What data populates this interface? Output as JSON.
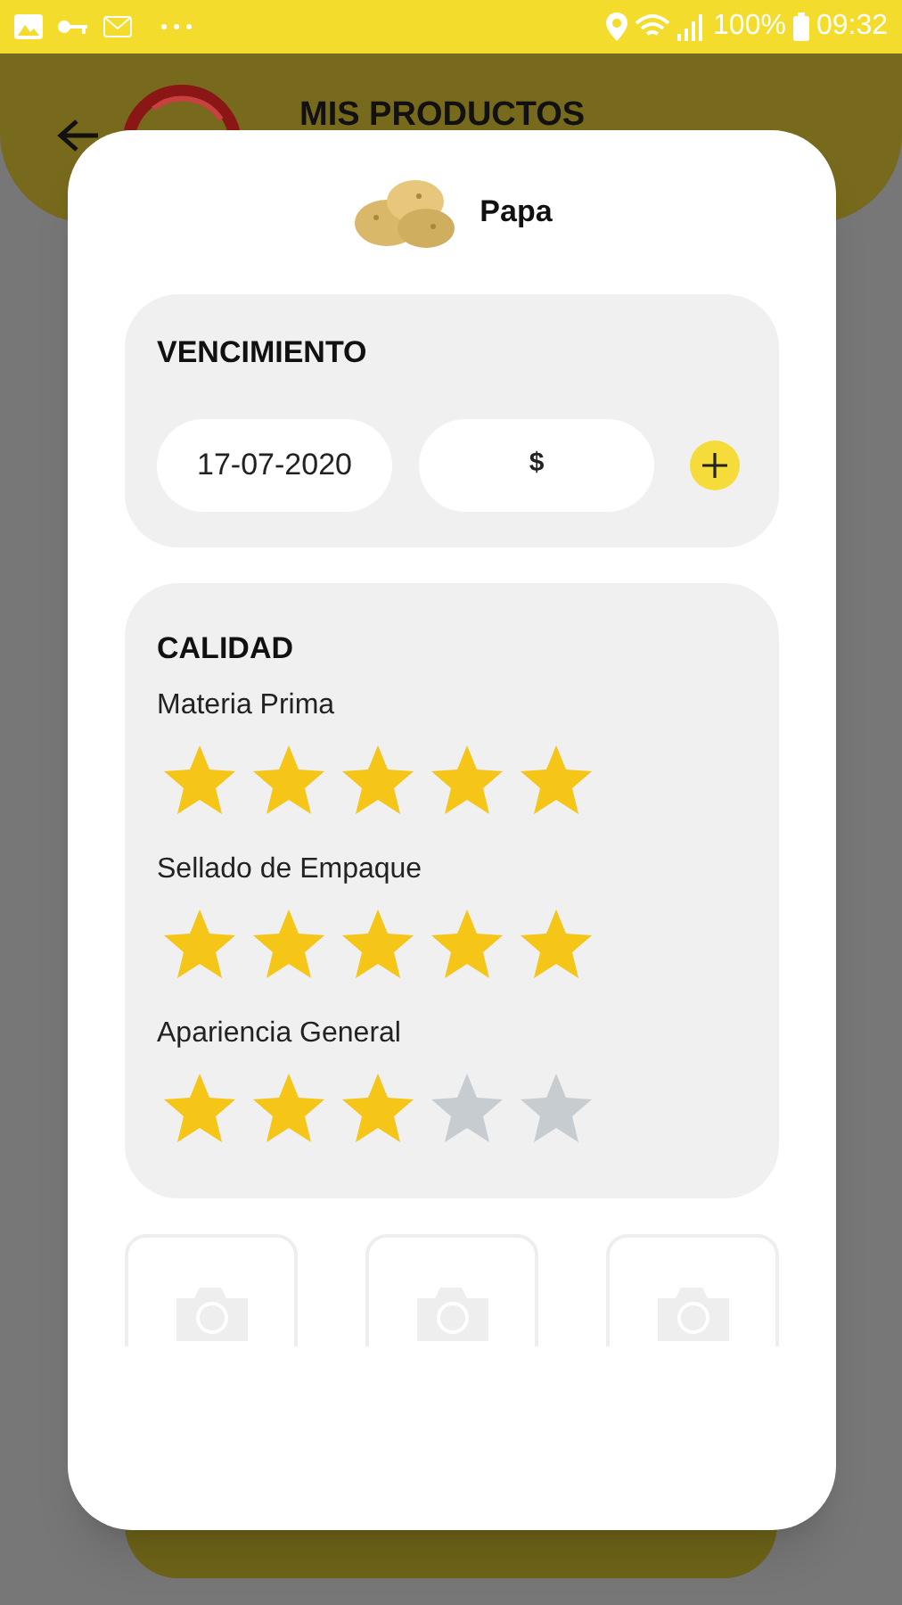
{
  "status_bar": {
    "battery": "100%",
    "time": "09:32"
  },
  "header": {
    "title": "MIS PRODUCTOS"
  },
  "dialog": {
    "product": {
      "name": "Papa"
    },
    "expiry": {
      "title": "VENCIMIENTO",
      "date": "17-07-2020",
      "price_prefix": "$"
    },
    "quality": {
      "title": "CALIDAD",
      "criteria": [
        {
          "label": "Materia Prima",
          "stars": 5
        },
        {
          "label": "Sellado de Empaque",
          "stars": 5
        },
        {
          "label": "Apariencia General",
          "stars": 3
        }
      ]
    },
    "photo_slots": [
      {
        "kind": "camera"
      },
      {
        "kind": "camera"
      },
      {
        "kind": "camera"
      }
    ]
  }
}
